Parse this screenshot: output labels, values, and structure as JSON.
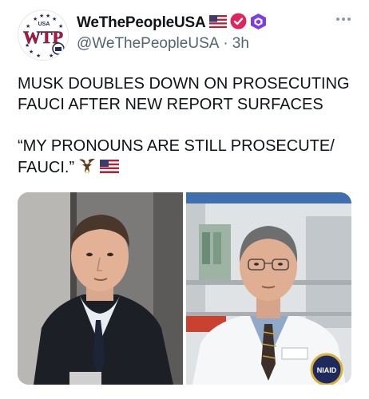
{
  "tweet": {
    "author": {
      "display_name": "WeThePeopleUSA",
      "handle": "@WeThePeopleUSA",
      "avatar_text": "WTP",
      "avatar_top_text": "USA"
    },
    "separator": "·",
    "timestamp": "3h",
    "badges": [
      "us-flag-icon",
      "verified-red-check-icon",
      "purple-hexagon-badge-icon"
    ],
    "text": {
      "line1": "MUSK DOUBLES DOWN ON PROSECUTING FAUCI AFTER NEW REPORT SURFACES",
      "line2": "“MY PRONOUNS ARE STILL PROSECUTE/ FAUCI.”"
    },
    "emojis": [
      "eagle-icon",
      "us-flag-icon"
    ],
    "media": {
      "photo_right_badge": "NIAID"
    }
  },
  "colors": {
    "verified_red": "#e0245e",
    "badge_purple": "#7b3fe4",
    "avatar_red": "#c8102e",
    "avatar_navy": "#1f2a5a",
    "text_primary": "#0f1419",
    "text_secondary": "#536471"
  }
}
